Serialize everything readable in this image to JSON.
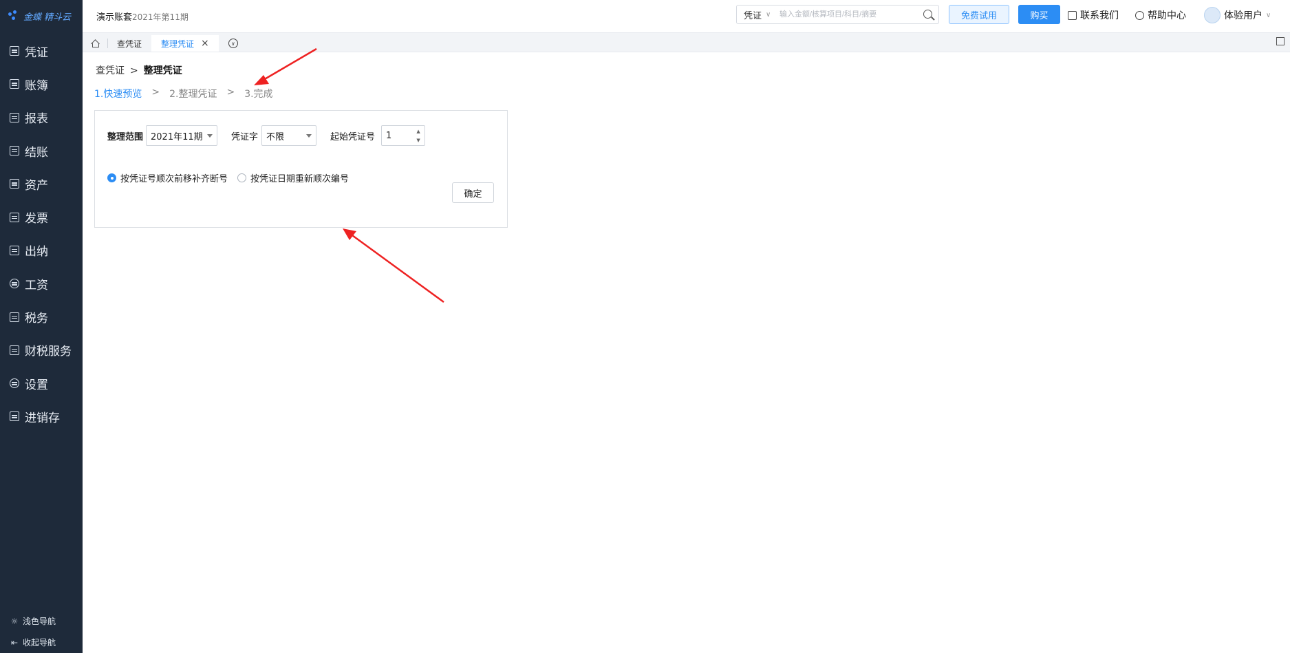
{
  "sidebar": {
    "logo_text": "金蝶 精斗云",
    "items": [
      {
        "label": "凭证",
        "icon": "voucher-icon"
      },
      {
        "label": "账簿",
        "icon": "ledger-icon"
      },
      {
        "label": "报表",
        "icon": "report-icon"
      },
      {
        "label": "结账",
        "icon": "closing-icon"
      },
      {
        "label": "资产",
        "icon": "asset-icon"
      },
      {
        "label": "发票",
        "icon": "invoice-icon"
      },
      {
        "label": "出纳",
        "icon": "cashier-icon"
      },
      {
        "label": "工资",
        "icon": "salary-icon"
      },
      {
        "label": "税务",
        "icon": "tax-icon"
      },
      {
        "label": "财税服务",
        "icon": "finance-service-icon"
      },
      {
        "label": "设置",
        "icon": "settings-icon"
      },
      {
        "label": "进销存",
        "icon": "inventory-icon"
      }
    ],
    "light_nav": "浅色导航",
    "collapse_nav": "收起导航"
  },
  "topbar": {
    "account_name": "演示账套",
    "period": "2021年第11期",
    "search_type": "凭证",
    "search_placeholder": "输入金额/核算项目/科目/摘要",
    "trial_label": "免费试用",
    "buy_label": "购买",
    "contact_label": "联系我们",
    "help_label": "帮助中心",
    "user_label": "体验用户"
  },
  "tabs": [
    {
      "label": "查凭证"
    },
    {
      "label": "整理凭证",
      "active": true
    }
  ],
  "breadcrumb": {
    "parent": "查凭证",
    "separator": ">",
    "current": "整理凭证"
  },
  "steps": [
    {
      "label": "1.快速预览",
      "active": true
    },
    {
      "label": "2.整理凭证",
      "active": false
    },
    {
      "label": "3.完成",
      "active": false
    }
  ],
  "step_separator": ">",
  "form": {
    "range_label": "整理范围",
    "range_value": "2021年11期",
    "voucher_word_label": "凭证字",
    "voucher_word_value": "不限",
    "start_no_label": "起始凭证号",
    "start_no_value": "1",
    "option_shift": "按凭证号顺次前移补齐断号",
    "option_by_date": "按凭证日期重新顺次编号",
    "confirm_label": "确定"
  },
  "colors": {
    "accent": "#2c8df4",
    "sidebar_bg": "#1e2a3a",
    "annotation_arrow": "#ee2222"
  }
}
